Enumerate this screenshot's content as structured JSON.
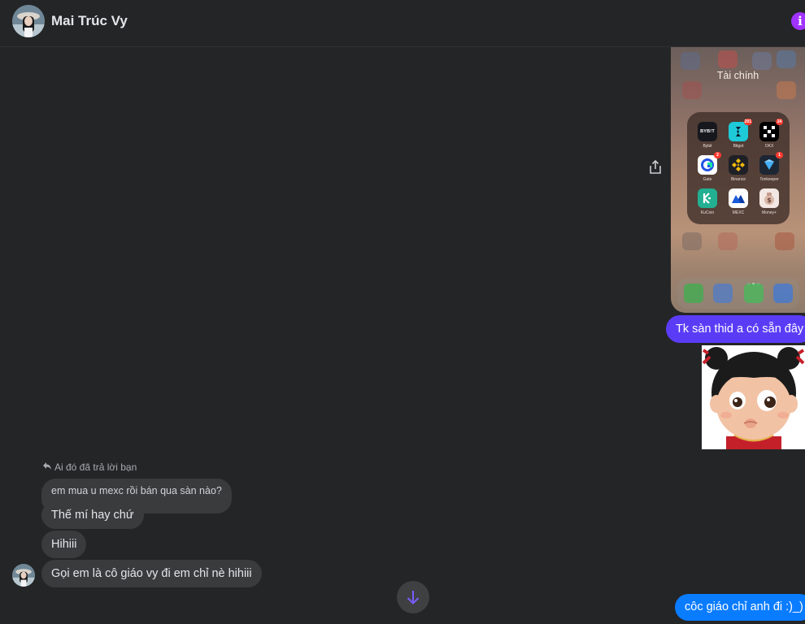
{
  "header": {
    "contact_name": "Mai Trúc Vy",
    "avatar_icon": "profile-photo",
    "info_icon": "info-icon",
    "info_glyph": "i",
    "accent_color": "#a033ff"
  },
  "phone_screenshot": {
    "folder_title": "Tài chính",
    "apps": [
      {
        "label": "Bybit",
        "icon_text": "BYBIT",
        "color": "#17181e",
        "badge": ""
      },
      {
        "label": "Bitget",
        "icon_text": "",
        "color": "#1ec9d8",
        "badge": "201"
      },
      {
        "label": "OKX",
        "icon_text": "",
        "color": "#000000",
        "badge": "24"
      },
      {
        "label": "Gate",
        "icon_text": "",
        "color": "#ffffff",
        "badge": "2"
      },
      {
        "label": "Binance",
        "icon_text": "",
        "color": "#1e2026",
        "badge": ""
      },
      {
        "label": "Tonkeeper",
        "icon_text": "",
        "color": "#1d2633",
        "badge": "1"
      },
      {
        "label": "KuCoin",
        "icon_text": "",
        "color": "#23af91",
        "badge": ""
      },
      {
        "label": "MEXC",
        "icon_text": "",
        "color": "#ffffff",
        "badge": ""
      },
      {
        "label": "Money+",
        "icon_text": "",
        "color": "#f3e7e3",
        "badge": ""
      }
    ]
  },
  "messages": {
    "outgoing_1": "Tk sàn thid a có sẵn đây",
    "outgoing_2": "côc giáo chỉ anh đi :)_)",
    "reply_note": "Ai đó đã trả lời bạn",
    "quoted_text": "em mua u mexc rồi bán qua sàn nào?",
    "incoming": [
      "Thế mí hay chứ",
      "Hihiii",
      "Gọi em là cô giáo vy đi em chỉ nè hihiii"
    ]
  },
  "colors": {
    "outgoing_bubble": "#5b3cf6",
    "outgoing_bubble_last": "#0a7cff",
    "incoming_bubble": "#3a3b3c",
    "background": "#242526"
  },
  "icons": {
    "share": "share-icon",
    "scroll_down": "arrow-down-icon",
    "reply": "reply-arrow-icon"
  }
}
